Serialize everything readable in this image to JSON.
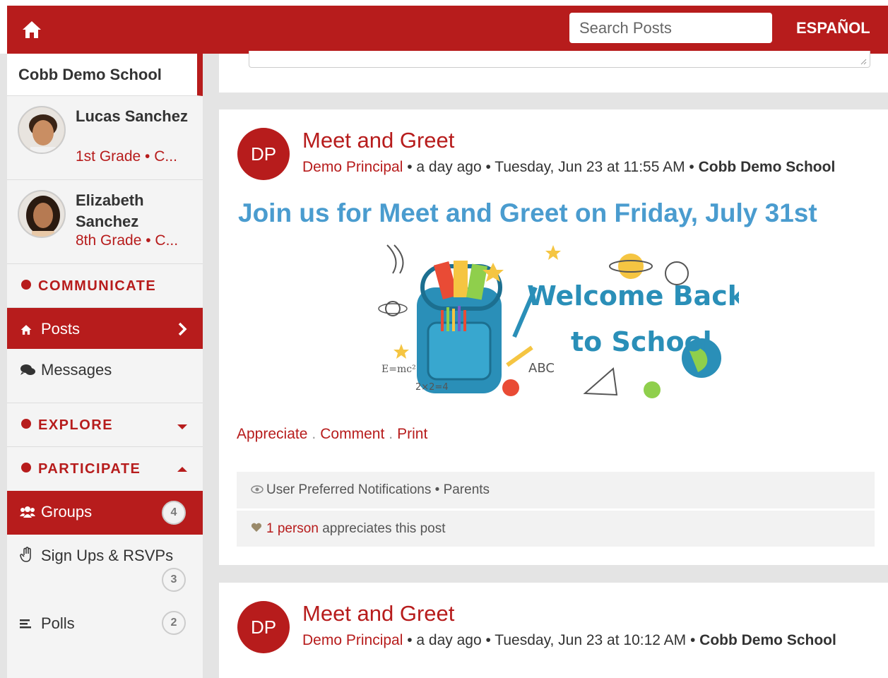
{
  "topbar": {
    "search_placeholder": "Search Posts",
    "language_label": "ESPAÑOL"
  },
  "sidebar": {
    "school_name": "Cobb Demo School",
    "children": [
      {
        "name": "Lucas Sanchez",
        "grade": "1st Grade • C..."
      },
      {
        "name": "Elizabeth Sanchez",
        "grade": "8th Grade • C..."
      }
    ],
    "communicate_label": "COMMUNICATE",
    "posts_label": "Posts",
    "messages_label": "Messages",
    "explore_label": "EXPLORE",
    "participate_label": "PARTICIPATE",
    "groups_label": "Groups",
    "groups_count": "4",
    "signups_label": "Sign Ups & RSVPs",
    "signups_count": "3",
    "polls_label": "Polls",
    "polls_count": "2"
  },
  "posts": [
    {
      "initials": "DP",
      "title": "Meet and Greet",
      "author": "Demo Principal",
      "meta": " • a day ago • Tuesday, Jun 23 at 11:55 AM • ",
      "school": "Cobb Demo School",
      "headline": "Join us for Meet and Greet on Friday, July 31st",
      "banner_line1": "Welcome Back",
      "banner_line2": "to School",
      "actions": [
        "Appreciate",
        "Comment",
        "Print"
      ],
      "notifications": "User Preferred Notifications • Parents",
      "appreciation_link": "1 person",
      "appreciation_text": " appreciates this post"
    },
    {
      "initials": "DP",
      "title": "Meet and Greet",
      "author": "Demo Principal",
      "meta": " • a day ago • Tuesday, Jun 23 at 10:12 AM • ",
      "school": "Cobb Demo School"
    }
  ],
  "colors": {
    "brand_red": "#b71c1c",
    "headline_blue": "#4a9ccf"
  }
}
